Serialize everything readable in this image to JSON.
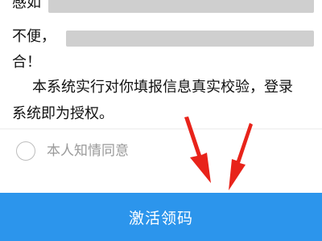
{
  "consent": {
    "line1_start": "感如",
    "line2_start": "不便，",
    "line3": "合！",
    "paragraph_line1": "本系统实行对你填报信息真实校验，登录",
    "paragraph_line2": "系统即为授权。",
    "checkbox_label": "本人知情同意",
    "checked": false
  },
  "actions": {
    "activate_label": "激活领码"
  },
  "colors": {
    "primary_button": "#2c95ec",
    "annotation_arrow": "#e8231a",
    "muted_text": "#9a9a9a"
  }
}
